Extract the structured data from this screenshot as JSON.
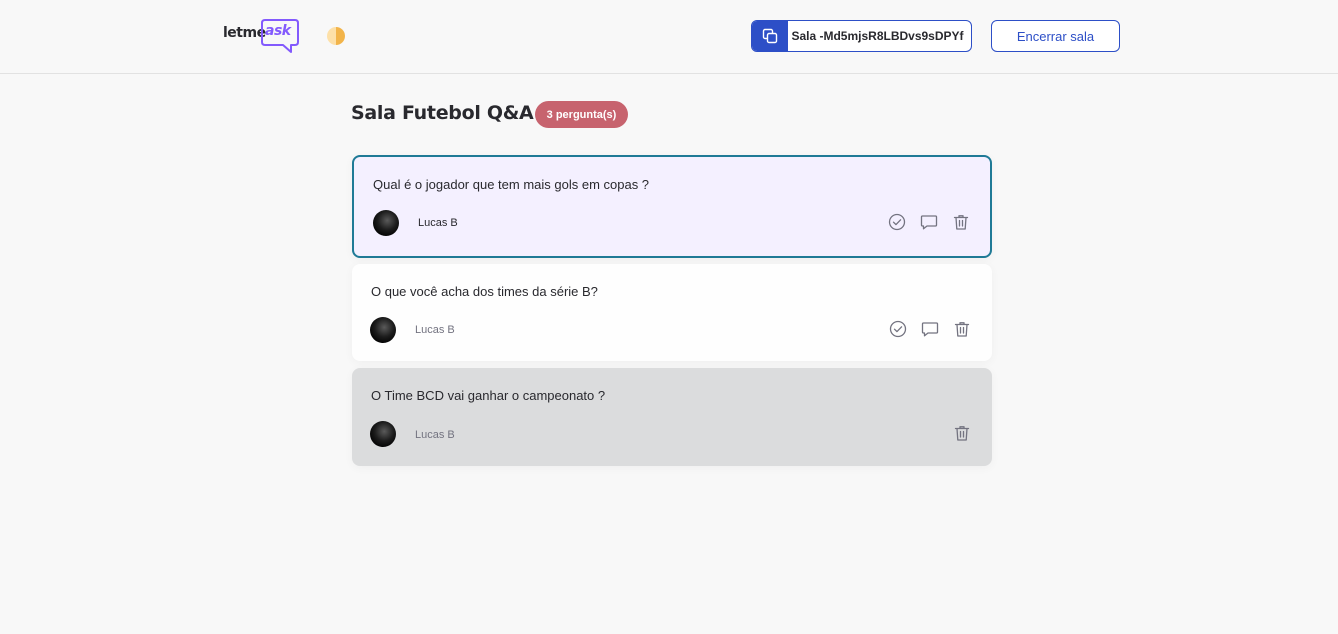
{
  "header": {
    "logo": {
      "part1": "letme",
      "part2": "ask"
    },
    "theme_toggle_icon": "half-moon-icon",
    "room_code": {
      "text": "Sala -Md5mjsR8LBDvs9sDPYf",
      "icon": "copy-icon"
    },
    "close_room_label": "Encerrar sala"
  },
  "room": {
    "title": "Sala Futebol Q&A",
    "question_count": "3 pergunta(s)"
  },
  "questions": [
    {
      "text": "Qual é o jogador que tem mais gols em copas ?",
      "author": "Lucas B",
      "state": "highlighted",
      "actions": [
        "check-circle-icon",
        "chat-bubble-icon",
        "trash-icon"
      ]
    },
    {
      "text": "O que você acha dos times da série B?",
      "author": "Lucas B",
      "state": "normal",
      "actions": [
        "check-circle-icon",
        "chat-bubble-icon",
        "trash-icon"
      ]
    },
    {
      "text": "O Time BCD vai ganhar o campeonato ?",
      "author": "Lucas B",
      "state": "answered",
      "actions": [
        "trash-icon"
      ]
    }
  ],
  "colors": {
    "brand": "#835afd",
    "primary_blue": "#2d4fc7",
    "badge": "#c7636e",
    "highlight_bg": "#f4f0ff",
    "highlight_border": "#1f7a96",
    "answered_bg": "#dbdcdd"
  }
}
